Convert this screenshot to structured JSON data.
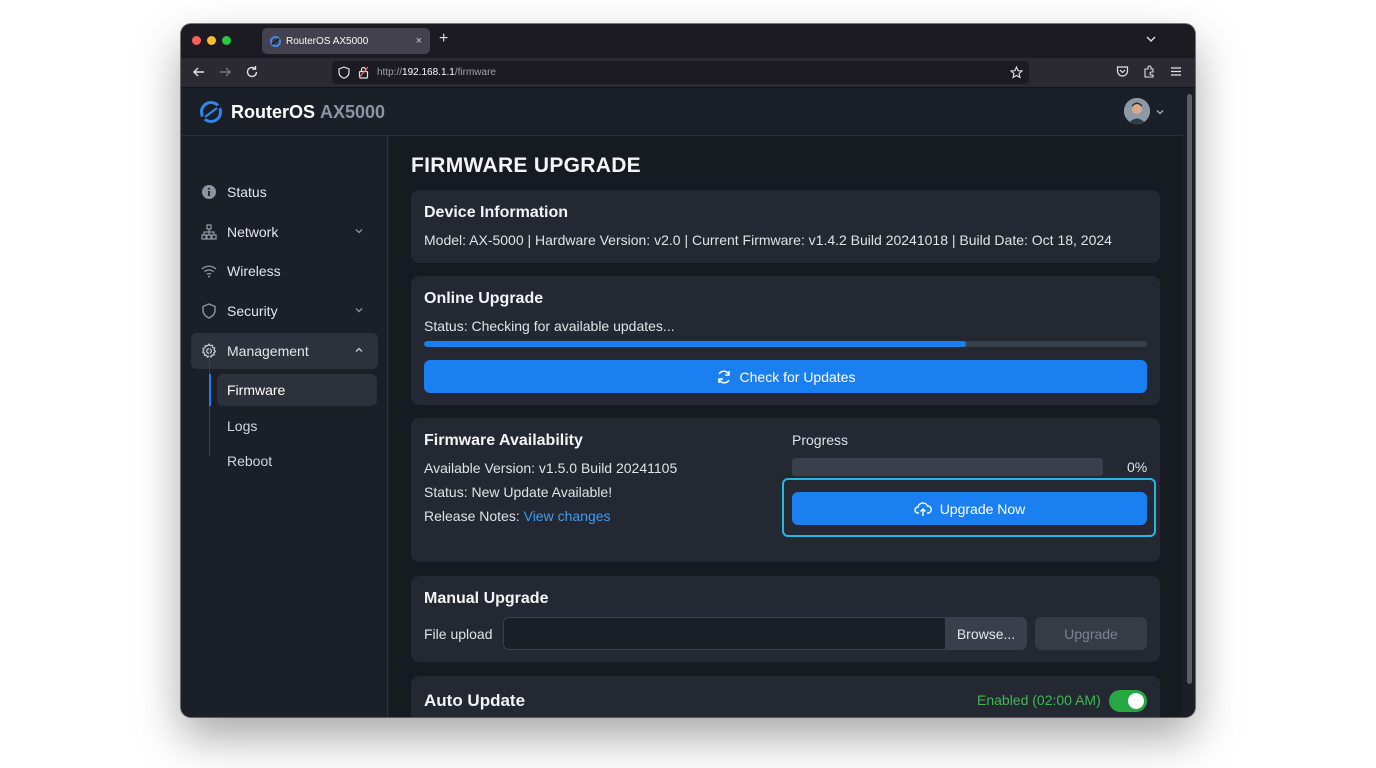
{
  "browser": {
    "tab_title": "RouterOS AX5000",
    "tab_close": "×",
    "new_tab": "+",
    "url_prefix": "http://",
    "url_host": "192.168.1.1",
    "url_path": "/firmware"
  },
  "header": {
    "brand_name": "RouterOS",
    "brand_model": "AX5000"
  },
  "sidebar": {
    "items": [
      {
        "label": "Status",
        "icon": "info-icon"
      },
      {
        "label": "Network",
        "icon": "network-icon"
      },
      {
        "label": "Wireless",
        "icon": "wifi-icon"
      },
      {
        "label": "Security",
        "icon": "shield-icon"
      },
      {
        "label": "Management",
        "icon": "gear-icon"
      }
    ],
    "sub_items": [
      {
        "label": "Firmware"
      },
      {
        "label": "Logs"
      },
      {
        "label": "Reboot"
      }
    ]
  },
  "page": {
    "title": "FIRMWARE UPGRADE"
  },
  "device_info": {
    "heading": "Device Information",
    "details": "Model: AX-5000 | Hardware Version: v2.0 | Current Firmware: v1.4.2 Build 20241018 | Build Date: Oct 18, 2024"
  },
  "online_upgrade": {
    "heading": "Online Upgrade",
    "status": "Status: Checking for available updates...",
    "progress": 0.75,
    "button_label": "Check for Updates"
  },
  "availability": {
    "heading": "Firmware Availability",
    "available_version": "Available Version: v1.5.0 Build 20241105",
    "status": "Status: New Update Available!",
    "release_notes_label": "Release Notes:",
    "release_notes_link": "View changes",
    "progress_label": "Progress",
    "progress_value": 0,
    "progress_text": "0%",
    "button_label": "Upgrade Now"
  },
  "manual_upgrade": {
    "heading": "Manual Upgrade",
    "file_label": "File upload",
    "browse_label": "Browse...",
    "upgrade_label": "Upgrade"
  },
  "auto_update": {
    "heading": "Auto Update",
    "status": "Enabled (02:00 AM)",
    "enabled": true
  },
  "colors": {
    "accent": "#1a7ff0",
    "success": "#3fb950",
    "link": "#3d9cf5",
    "focus_ring": "#25b7dd"
  }
}
